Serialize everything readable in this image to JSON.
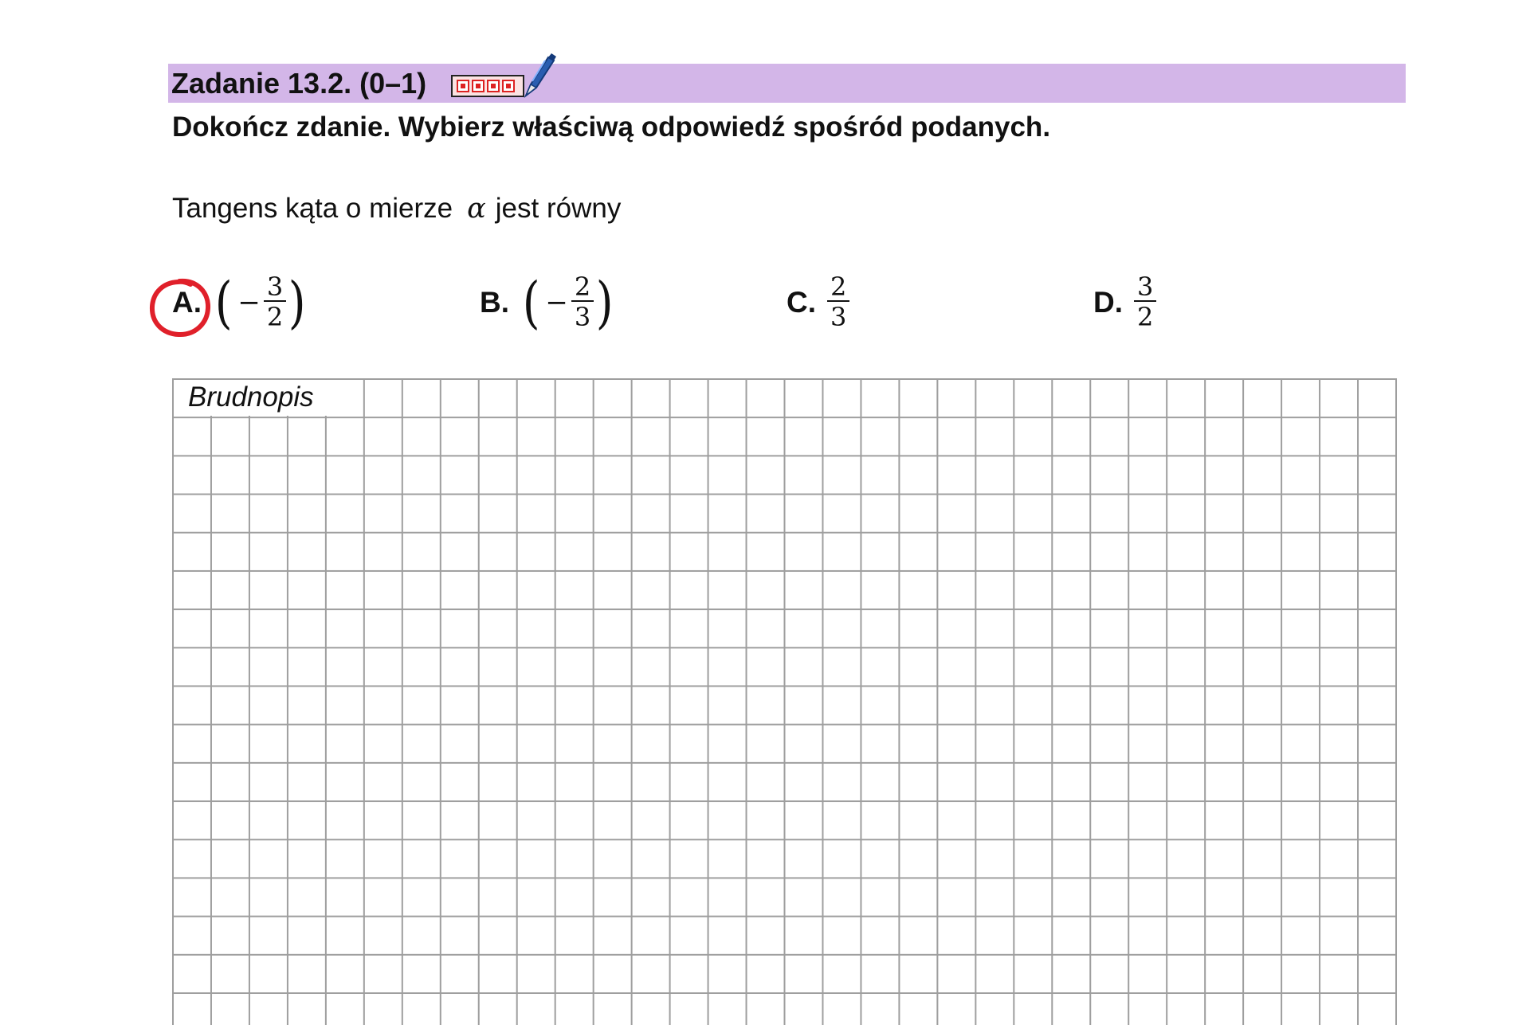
{
  "task": {
    "title": "Zadanie 13.2. (0–1)",
    "instruction": "Dokończ zdanie. Wybierz właściwą odpowiedź spośród podanych.",
    "question_before": "Tangens kąta o mierze",
    "question_symbol": "α",
    "question_after": "jest równy",
    "header_color": "#d3b6e8",
    "icons": [
      "hand-gesture-icon",
      "pen-icon"
    ]
  },
  "options": [
    {
      "letter": "A.",
      "paren": true,
      "sign": "−",
      "numerator": "3",
      "denominator": "2",
      "selected": true
    },
    {
      "letter": "B.",
      "paren": true,
      "sign": "−",
      "numerator": "2",
      "denominator": "3",
      "selected": false
    },
    {
      "letter": "C.",
      "paren": false,
      "sign": "",
      "numerator": "2",
      "denominator": "3",
      "selected": false
    },
    {
      "letter": "D.",
      "paren": false,
      "sign": "",
      "numerator": "3",
      "denominator": "2",
      "selected": false
    }
  ],
  "scratchpad": {
    "label": "Brudnopis"
  },
  "selection_mark_color": "#e0202a"
}
